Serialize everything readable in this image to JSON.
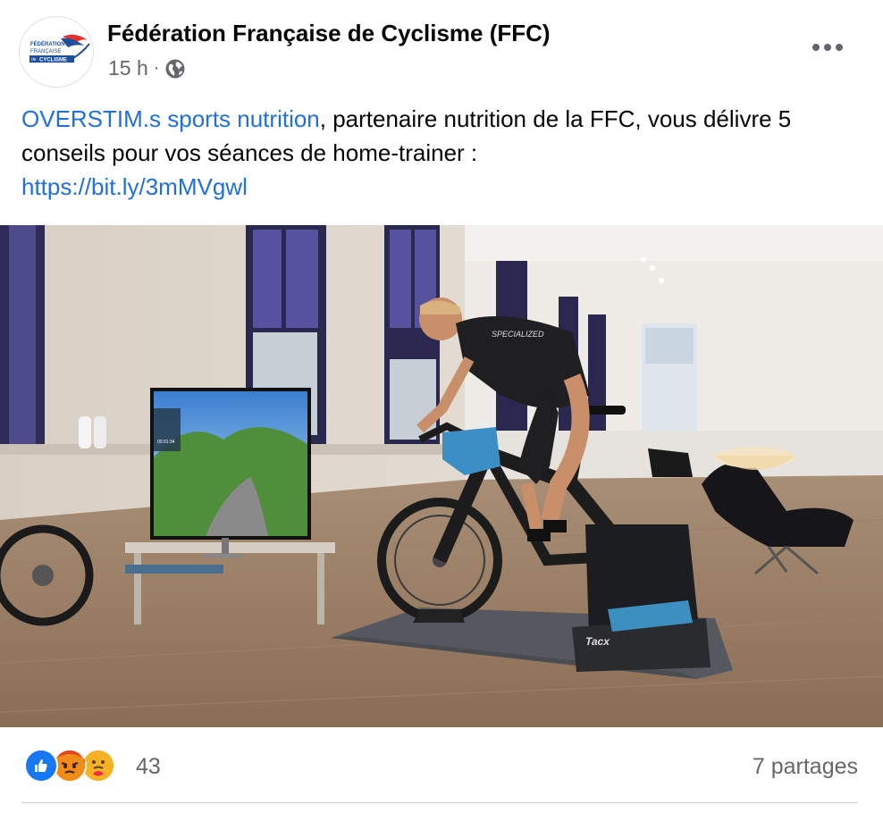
{
  "post": {
    "page_name": "Fédération Française de Cyclisme (FFC)",
    "time": "15 h",
    "separator": "·",
    "visibility_icon": "globe-icon",
    "more_icon": "more-options-icon",
    "text": {
      "mention": "OVERSTIM.s sports nutrition",
      "body": ", partenaire nutrition de la FFC, vous délivre 5 conseils pour vos séances de home-trainer :",
      "link": "https://bit.ly/3mMVgwl"
    },
    "avatar": {
      "line1": "FÉDÉRATION",
      "line2": "FRANÇAISE",
      "line3": "CYCLISME",
      "line_prefix": "de"
    },
    "photo": {
      "bike_brand": "SPECIALIZED",
      "trainer_brand": "Tacx",
      "screen_time": "00:01:34"
    }
  },
  "footer": {
    "reactions": [
      "like-icon",
      "angry-icon",
      "care-icon"
    ],
    "reaction_count": "43",
    "shares": "7 partages"
  },
  "colors": {
    "link": "#216fdb",
    "meta": "#65676b",
    "like": "#1877f2",
    "angry": "#e9710f",
    "care": "#f7b125"
  }
}
